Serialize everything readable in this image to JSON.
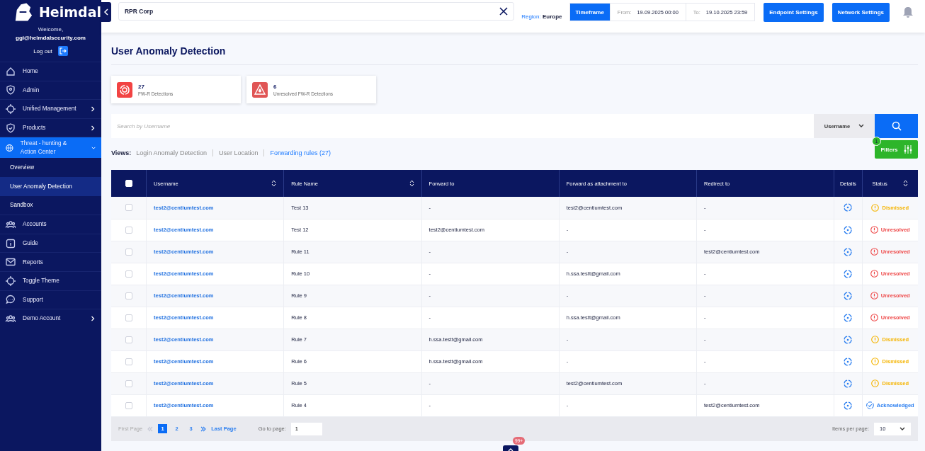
{
  "sidebar": {
    "brand": "Heimdal",
    "welcome": "Welcome,",
    "email": "ggi@heimdalsecurity.com",
    "logout": "Log out",
    "items": [
      {
        "label": "Home",
        "has_submenu": false,
        "expanded": false,
        "selected": false
      },
      {
        "label": "Admin",
        "has_submenu": false,
        "expanded": false,
        "selected": false
      },
      {
        "label": "Unified Management",
        "has_submenu": true,
        "expanded": false,
        "selected": false
      },
      {
        "label": "Products",
        "has_submenu": true,
        "expanded": false,
        "selected": false
      },
      {
        "label": "Threat - hunting & Action Center",
        "has_submenu": true,
        "expanded": true,
        "selected": true,
        "children": [
          {
            "label": "Overview",
            "selected": false
          },
          {
            "label": "User Anomaly Detection",
            "selected": true
          },
          {
            "label": "Sandbox",
            "selected": false
          }
        ]
      },
      {
        "label": "Accounts",
        "has_submenu": false,
        "expanded": false,
        "selected": false
      },
      {
        "label": "Guide",
        "has_submenu": false,
        "expanded": false,
        "selected": false
      },
      {
        "label": "Reports",
        "has_submenu": false,
        "expanded": false,
        "selected": false
      },
      {
        "label": "Toggle Theme",
        "has_submenu": false,
        "expanded": false,
        "selected": false
      },
      {
        "label": "Support",
        "has_submenu": false,
        "expanded": false,
        "selected": false
      },
      {
        "label": "Demo Account",
        "has_submenu": true,
        "expanded": false,
        "selected": false
      }
    ]
  },
  "topbar": {
    "customer": "RPR Corp",
    "region_label": "Region:",
    "region": "Europe",
    "timeframe": "Timeframe",
    "from_label": "From:",
    "from": "19.09.2025 00:00",
    "to_label": "To:",
    "to": "19.10.2025 23:59",
    "buttons": [
      "Endpoint Settings",
      "Network Settings"
    ]
  },
  "page": {
    "title": "User Anomaly Detection",
    "stats": [
      {
        "value": "27",
        "label": "FW-R Detections"
      },
      {
        "value": "6",
        "label": "Unresolved FW-R Detections"
      }
    ],
    "search": {
      "placeholder": "Search by Username",
      "field": "Username"
    },
    "views_label": "Views:",
    "views": [
      {
        "label": "Login Anomaly Detection",
        "selected": false
      },
      {
        "label": "User Location",
        "selected": false
      },
      {
        "label": "Forwarding rules (27)",
        "selected": true
      }
    ],
    "filters": {
      "label": "Filters",
      "count": "1"
    }
  },
  "table": {
    "select_all_checked": false,
    "columns": [
      {
        "label": "Username",
        "sortable": true
      },
      {
        "label": "Rule Name",
        "sortable": true
      },
      {
        "label": "Forward to",
        "sortable": false
      },
      {
        "label": "Forward as attachment to",
        "sortable": false
      },
      {
        "label": "Redirect to",
        "sortable": false
      },
      {
        "label": "Details",
        "sortable": false
      },
      {
        "label": "Status",
        "sortable": true
      }
    ],
    "rows": [
      {
        "checked": false,
        "username": "test2@centiumtest.com",
        "rule": "Test 13",
        "forward_to": "-",
        "attachment_to": "test2@centiumtest.com",
        "redirect_to": "-",
        "status": {
          "label": "Dismissed",
          "kind": "dismissed"
        }
      },
      {
        "checked": false,
        "username": "test2@centiumtest.com",
        "rule": "Test 12",
        "forward_to": "test2@centiumtest.com",
        "attachment_to": "-",
        "redirect_to": "-",
        "status": {
          "label": "Unresolved",
          "kind": "unresolved"
        }
      },
      {
        "checked": false,
        "username": "test2@centiumtest.com",
        "rule": "Rule 11",
        "forward_to": "-",
        "attachment_to": "-",
        "redirect_to": "test2@centiumtest.com",
        "status": {
          "label": "Unresolved",
          "kind": "unresolved"
        }
      },
      {
        "checked": false,
        "username": "test2@centiumtest.com",
        "rule": "Rule 10",
        "forward_to": "-",
        "attachment_to": "h.ssa.testt@gmail.com",
        "redirect_to": "-",
        "status": {
          "label": "Unresolved",
          "kind": "unresolved"
        }
      },
      {
        "checked": false,
        "username": "test2@centiumtest.com",
        "rule": "Rule 9",
        "forward_to": "-",
        "attachment_to": "-",
        "redirect_to": "-",
        "status": {
          "label": "Unresolved",
          "kind": "unresolved"
        }
      },
      {
        "checked": false,
        "username": "test2@centiumtest.com",
        "rule": "Rule 8",
        "forward_to": "-",
        "attachment_to": "h.ssa.testt@gmail.com",
        "redirect_to": "-",
        "status": {
          "label": "Unresolved",
          "kind": "unresolved"
        }
      },
      {
        "checked": false,
        "username": "test2@centiumtest.com",
        "rule": "Rule 7",
        "forward_to": "h.ssa.testt@gmail.com",
        "attachment_to": "-",
        "redirect_to": "-",
        "status": {
          "label": "Dismissed",
          "kind": "dismissed"
        }
      },
      {
        "checked": false,
        "username": "test2@centiumtest.com",
        "rule": "Rule 6",
        "forward_to": "h.ssa.testt@gmail.com",
        "attachment_to": "-",
        "redirect_to": "-",
        "status": {
          "label": "Dismissed",
          "kind": "dismissed"
        }
      },
      {
        "checked": false,
        "username": "test2@centiumtest.com",
        "rule": "Rule 5",
        "forward_to": "-",
        "attachment_to": "test2@centiumtest.com",
        "redirect_to": "-",
        "status": {
          "label": "Dismissed",
          "kind": "dismissed"
        }
      },
      {
        "checked": false,
        "username": "test2@centiumtest.com",
        "rule": "Rule 4",
        "forward_to": "-",
        "attachment_to": "-",
        "redirect_to": "test2@centiumtest.com",
        "status": {
          "label": "Acknowledged",
          "kind": "acknowledged"
        }
      }
    ]
  },
  "pagination": {
    "first": "First Page",
    "first_disabled": true,
    "pages": [
      {
        "label": "1",
        "selected": true
      },
      {
        "label": "2",
        "selected": false
      },
      {
        "label": "3",
        "selected": false
      }
    ],
    "last": "Last Page",
    "goto_label": "Go to page:",
    "goto_value": "1",
    "per_page_label": "Items per page:",
    "per_page": "10"
  },
  "notifications": {
    "badge": "99+"
  }
}
